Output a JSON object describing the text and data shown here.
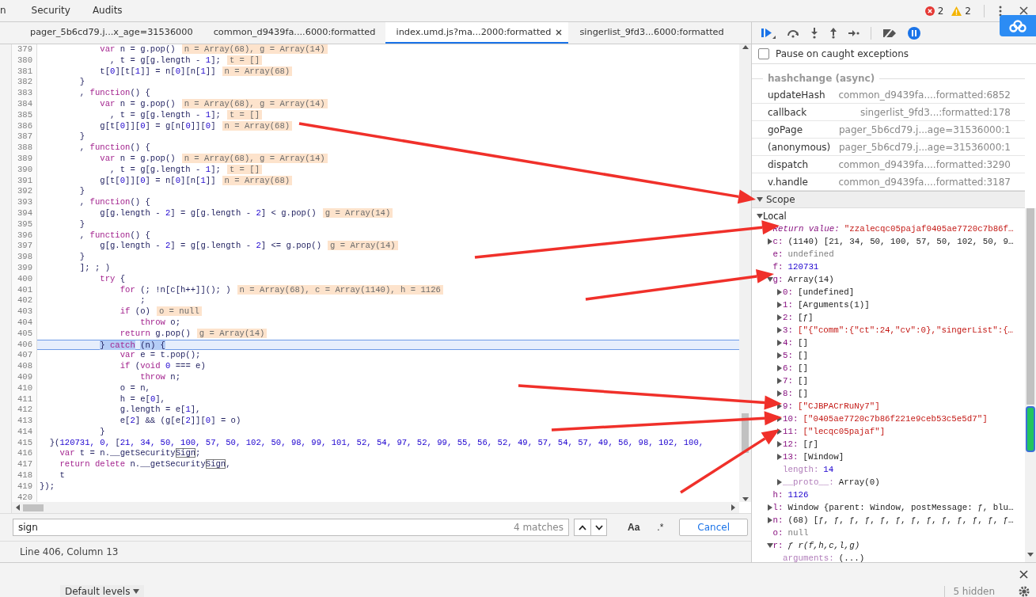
{
  "top_tabs": [
    {
      "label": "n",
      "selected": false
    },
    {
      "label": "Security",
      "selected": false
    },
    {
      "label": "Audits",
      "selected": false
    }
  ],
  "errors": "2",
  "warnings": "2",
  "file_tabs": [
    {
      "label": "pager_5b6cd79.j...x_age=31536000",
      "selected": false
    },
    {
      "label": "common_d9439fa....6000:formatted",
      "selected": false
    },
    {
      "label": "index.umd.js?ma...2000:formatted",
      "selected": true
    },
    {
      "label": "singerlist_9fd3...6000:formatted",
      "selected": false
    }
  ],
  "code_lines": [
    {
      "num": "379",
      "current": false,
      "tokens": [
        {
          "kind": "keyword",
          "text": "            var"
        },
        {
          "kind": "plain",
          "text": " n = g.pop()"
        }
      ],
      "inline": "n = Array(68), g = Array(14)"
    },
    {
      "num": "380",
      "current": false,
      "tokens": [
        {
          "kind": "plain",
          "text": "              , t = g[g.length - "
        },
        {
          "kind": "number",
          "text": "1"
        },
        {
          "kind": "plain",
          "text": "];"
        }
      ],
      "inline": "t = []"
    },
    {
      "num": "381",
      "current": false,
      "tokens": [
        {
          "kind": "plain",
          "text": "            t["
        },
        {
          "kind": "number",
          "text": "0"
        },
        {
          "kind": "plain",
          "text": "][t["
        },
        {
          "kind": "number",
          "text": "1"
        },
        {
          "kind": "plain",
          "text": "]] = n["
        },
        {
          "kind": "number",
          "text": "0"
        },
        {
          "kind": "plain",
          "text": "][n["
        },
        {
          "kind": "number",
          "text": "1"
        },
        {
          "kind": "plain",
          "text": "]]"
        }
      ],
      "inline": "n = Array(68)"
    },
    {
      "num": "382",
      "current": false,
      "tokens": [
        {
          "kind": "plain",
          "text": "        }"
        }
      ]
    },
    {
      "num": "383",
      "current": false,
      "tokens": [
        {
          "kind": "plain",
          "text": "        , "
        },
        {
          "kind": "keyword",
          "text": "function"
        },
        {
          "kind": "plain",
          "text": "() {"
        }
      ]
    },
    {
      "num": "384",
      "current": false,
      "tokens": [
        {
          "kind": "keyword",
          "text": "            var"
        },
        {
          "kind": "plain",
          "text": " n = g.pop()"
        }
      ],
      "inline": "n = Array(68), g = Array(14)"
    },
    {
      "num": "385",
      "current": false,
      "tokens": [
        {
          "kind": "plain",
          "text": "              , t = g[g.length - "
        },
        {
          "kind": "number",
          "text": "1"
        },
        {
          "kind": "plain",
          "text": "];"
        }
      ],
      "inline": "t = []"
    },
    {
      "num": "386",
      "current": false,
      "tokens": [
        {
          "kind": "plain",
          "text": "            g[t["
        },
        {
          "kind": "number",
          "text": "0"
        },
        {
          "kind": "plain",
          "text": "]]["
        },
        {
          "kind": "number",
          "text": "0"
        },
        {
          "kind": "plain",
          "text": "] = g[n["
        },
        {
          "kind": "number",
          "text": "0"
        },
        {
          "kind": "plain",
          "text": "]]["
        },
        {
          "kind": "number",
          "text": "0"
        },
        {
          "kind": "plain",
          "text": "]"
        }
      ],
      "inline": "n = Array(68)"
    },
    {
      "num": "387",
      "current": false,
      "tokens": [
        {
          "kind": "plain",
          "text": "        }"
        }
      ]
    },
    {
      "num": "388",
      "current": false,
      "tokens": [
        {
          "kind": "plain",
          "text": "        , "
        },
        {
          "kind": "keyword",
          "text": "function"
        },
        {
          "kind": "plain",
          "text": "() {"
        }
      ]
    },
    {
      "num": "389",
      "current": false,
      "tokens": [
        {
          "kind": "keyword",
          "text": "            var"
        },
        {
          "kind": "plain",
          "text": " n = g.pop()"
        }
      ],
      "inline": "n = Array(68), g = Array(14)"
    },
    {
      "num": "390",
      "current": false,
      "tokens": [
        {
          "kind": "plain",
          "text": "              , t = g[g.length - "
        },
        {
          "kind": "number",
          "text": "1"
        },
        {
          "kind": "plain",
          "text": "];"
        }
      ],
      "inline": "t = []"
    },
    {
      "num": "391",
      "current": false,
      "tokens": [
        {
          "kind": "plain",
          "text": "            g[t["
        },
        {
          "kind": "number",
          "text": "0"
        },
        {
          "kind": "plain",
          "text": "]]["
        },
        {
          "kind": "number",
          "text": "0"
        },
        {
          "kind": "plain",
          "text": "] = n["
        },
        {
          "kind": "number",
          "text": "0"
        },
        {
          "kind": "plain",
          "text": "][n["
        },
        {
          "kind": "number",
          "text": "1"
        },
        {
          "kind": "plain",
          "text": "]]"
        }
      ],
      "inline": "n = Array(68)"
    },
    {
      "num": "392",
      "current": false,
      "tokens": [
        {
          "kind": "plain",
          "text": "        }"
        }
      ]
    },
    {
      "num": "393",
      "current": false,
      "tokens": [
        {
          "kind": "plain",
          "text": "        , "
        },
        {
          "kind": "keyword",
          "text": "function"
        },
        {
          "kind": "plain",
          "text": "() {"
        }
      ]
    },
    {
      "num": "394",
      "current": false,
      "tokens": [
        {
          "kind": "plain",
          "text": "            g[g.length - "
        },
        {
          "kind": "number",
          "text": "2"
        },
        {
          "kind": "plain",
          "text": "] = g[g.length - "
        },
        {
          "kind": "number",
          "text": "2"
        },
        {
          "kind": "plain",
          "text": "] < g.pop()"
        }
      ],
      "inline": "g = Array(14)"
    },
    {
      "num": "395",
      "current": false,
      "tokens": [
        {
          "kind": "plain",
          "text": "        }"
        }
      ]
    },
    {
      "num": "396",
      "current": false,
      "tokens": [
        {
          "kind": "plain",
          "text": "        , "
        },
        {
          "kind": "keyword",
          "text": "function"
        },
        {
          "kind": "plain",
          "text": "() {"
        }
      ]
    },
    {
      "num": "397",
      "current": false,
      "tokens": [
        {
          "kind": "plain",
          "text": "            g[g.length - "
        },
        {
          "kind": "number",
          "text": "2"
        },
        {
          "kind": "plain",
          "text": "] = g[g.length - "
        },
        {
          "kind": "number",
          "text": "2"
        },
        {
          "kind": "plain",
          "text": "] <= g.pop()"
        }
      ],
      "inline": "g = Array(14)"
    },
    {
      "num": "398",
      "current": false,
      "tokens": [
        {
          "kind": "plain",
          "text": "        }"
        }
      ]
    },
    {
      "num": "399",
      "current": false,
      "tokens": [
        {
          "kind": "plain",
          "text": "        ]; ; )"
        }
      ]
    },
    {
      "num": "400",
      "current": false,
      "tokens": [
        {
          "kind": "keyword",
          "text": "            try"
        },
        {
          "kind": "plain",
          "text": " {"
        }
      ]
    },
    {
      "num": "401",
      "current": false,
      "tokens": [
        {
          "kind": "keyword",
          "text": "                for"
        },
        {
          "kind": "plain",
          "text": " (; !n[c[h++]](); )"
        }
      ],
      "inline": "n = Array(68), c = Array(1140), h = 1126"
    },
    {
      "num": "402",
      "current": false,
      "tokens": [
        {
          "kind": "plain",
          "text": "                    ;"
        }
      ]
    },
    {
      "num": "403",
      "current": false,
      "tokens": [
        {
          "kind": "keyword",
          "text": "                if"
        },
        {
          "kind": "plain",
          "text": " (o)"
        }
      ],
      "inline": "o = null"
    },
    {
      "num": "404",
      "current": false,
      "tokens": [
        {
          "kind": "keyword",
          "text": "                    throw"
        },
        {
          "kind": "plain",
          "text": " o;"
        }
      ]
    },
    {
      "num": "405",
      "current": false,
      "tokens": [
        {
          "kind": "keyword",
          "text": "                return"
        },
        {
          "kind": "plain",
          "text": " g.pop()"
        }
      ],
      "inline": "g = Array(14)"
    },
    {
      "num": "406",
      "current": true,
      "tokens": [
        {
          "kind": "selected_plain",
          "text": "            } "
        },
        {
          "kind": "selected_keyword",
          "text": "catch"
        },
        {
          "kind": "selected_plain",
          "text": " (n) {"
        }
      ]
    },
    {
      "num": "407",
      "current": false,
      "tokens": [
        {
          "kind": "keyword",
          "text": "                var"
        },
        {
          "kind": "plain",
          "text": " e = t.pop();"
        }
      ]
    },
    {
      "num": "408",
      "current": false,
      "tokens": [
        {
          "kind": "keyword",
          "text": "                if"
        },
        {
          "kind": "plain",
          "text": " ("
        },
        {
          "kind": "keyword",
          "text": "void"
        },
        {
          "kind": "number",
          "text": " 0"
        },
        {
          "kind": "plain",
          "text": " === e)"
        }
      ]
    },
    {
      "num": "409",
      "current": false,
      "tokens": [
        {
          "kind": "keyword",
          "text": "                    throw"
        },
        {
          "kind": "plain",
          "text": " n;"
        }
      ]
    },
    {
      "num": "410",
      "current": false,
      "tokens": [
        {
          "kind": "plain",
          "text": "                o = n,"
        }
      ]
    },
    {
      "num": "411",
      "current": false,
      "tokens": [
        {
          "kind": "plain",
          "text": "                h = e["
        },
        {
          "kind": "number",
          "text": "0"
        },
        {
          "kind": "plain",
          "text": "],"
        }
      ]
    },
    {
      "num": "412",
      "current": false,
      "tokens": [
        {
          "kind": "plain",
          "text": "                g.length = e["
        },
        {
          "kind": "number",
          "text": "1"
        },
        {
          "kind": "plain",
          "text": "],"
        }
      ]
    },
    {
      "num": "413",
      "current": false,
      "tokens": [
        {
          "kind": "plain",
          "text": "                e["
        },
        {
          "kind": "number",
          "text": "2"
        },
        {
          "kind": "plain",
          "text": "] && (g[e["
        },
        {
          "kind": "number",
          "text": "2"
        },
        {
          "kind": "plain",
          "text": "]]["
        },
        {
          "kind": "number",
          "text": "0"
        },
        {
          "kind": "plain",
          "text": "] = o)"
        }
      ]
    },
    {
      "num": "414",
      "current": false,
      "tokens": [
        {
          "kind": "plain",
          "text": "            }"
        }
      ]
    },
    {
      "num": "415",
      "current": false,
      "tokens": [
        {
          "kind": "plain",
          "text": "  }("
        },
        {
          "kind": "number",
          "text": "120731, 0, "
        },
        {
          "kind": "plain",
          "text": "["
        },
        {
          "kind": "number",
          "text": "21, 34, 50, 100, 57, 50, 102, 50, 98, 99, 101, 52, 54, 97, 52, 99, 55, 56, 52, 49, 57, 54, 57, 49, 56, 98, 102, 100,"
        }
      ]
    },
    {
      "num": "416",
      "current": false,
      "tokens": [
        {
          "kind": "keyword",
          "text": "    var"
        },
        {
          "kind": "plain",
          "text": " t = n.__getSecurity"
        },
        {
          "kind": "match",
          "text": "Sign"
        },
        {
          "kind": "plain",
          "text": ";"
        }
      ]
    },
    {
      "num": "417",
      "current": false,
      "tokens": [
        {
          "kind": "keyword",
          "text": "    return delete"
        },
        {
          "kind": "plain",
          "text": " n.__getSecurity"
        },
        {
          "kind": "match",
          "text": "Sign"
        },
        {
          "kind": "plain",
          "text": ","
        }
      ]
    },
    {
      "num": "418",
      "current": false,
      "tokens": [
        {
          "kind": "plain",
          "text": "    t"
        }
      ]
    },
    {
      "num": "419",
      "current": false,
      "tokens": [
        {
          "kind": "plain",
          "text": "});"
        }
      ]
    },
    {
      "num": "420",
      "current": false
    }
  ],
  "search": {
    "value": "sign",
    "matches": "4 matches",
    "case_label": "Aa",
    "regex_label": ".*",
    "cancel": "Cancel"
  },
  "status": "Line 406, Column 13",
  "pause_on_caught": {
    "label": "Pause on caught exceptions",
    "checked": false
  },
  "call_stack": {
    "async_label": "hashchange (async)",
    "frames": [
      {
        "name": "updateHash",
        "location": "common_d9439fa....formatted:6852"
      },
      {
        "name": "callback",
        "location": "singerlist_9fd3...:formatted:178"
      },
      {
        "name": "goPage",
        "location": "pager_5b6cd79.j...age=31536000:1"
      },
      {
        "name": "(anonymous)",
        "location": "pager_5b6cd79.j...age=31536000:1"
      },
      {
        "name": "dispatch",
        "location": "common_d9439fa....formatted:3290"
      },
      {
        "name": "v.handle",
        "location": "common_d9439fa....formatted:3187"
      }
    ]
  },
  "scope": {
    "title": "Scope",
    "expanded": true,
    "tree": [
      {
        "name": "Local",
        "kind": "scope",
        "expanded": true,
        "children": [
          {
            "name": "Return value:",
            "kind": "return",
            "value": {
              "kind": "string",
              "text": "\"zzalecqc05pajaf0405ae7720c7b86f…"
            }
          },
          {
            "name": "c:",
            "kind": "prop",
            "value": {
              "kind": "object",
              "text": "(1140) [21, 34, 50, 100, 57, 50, 102, 50, 9…"
            },
            "expanded": false
          },
          {
            "name": "e:",
            "kind": "prop",
            "value": {
              "kind": "empty",
              "text": "undefined"
            }
          },
          {
            "name": "f:",
            "kind": "prop",
            "value": {
              "kind": "number",
              "text": "120731"
            }
          },
          {
            "name": "g:",
            "kind": "prop",
            "value": {
              "kind": "object",
              "text": "Array(14)"
            },
            "expanded": true,
            "children": [
              {
                "name": "0:",
                "kind": "prop",
                "value": {
                  "kind": "object",
                  "text": "[undefined]"
                },
                "expanded": false
              },
              {
                "name": "1:",
                "kind": "prop",
                "value": {
                  "kind": "object",
                  "text": "[Arguments(1)]"
                },
                "expanded": false
              },
              {
                "name": "2:",
                "kind": "prop",
                "value": {
                  "kind": "object",
                  "text": "[ƒ]"
                },
                "expanded": false
              },
              {
                "name": "3:",
                "kind": "prop",
                "value": {
                  "kind": "string",
                  "text": "[\"{\"comm\":{\"ct\":24,\"cv\":0},\"singerList\":{…"
                },
                "expanded": false
              },
              {
                "name": "4:",
                "kind": "prop",
                "value": {
                  "kind": "object",
                  "text": "[]"
                },
                "expanded": false
              },
              {
                "name": "5:",
                "kind": "prop",
                "value": {
                  "kind": "object",
                  "text": "[]"
                },
                "expanded": false
              },
              {
                "name": "6:",
                "kind": "prop",
                "value": {
                  "kind": "object",
                  "text": "[]"
                },
                "expanded": false
              },
              {
                "name": "7:",
                "kind": "prop",
                "value": {
                  "kind": "object",
                  "text": "[]"
                },
                "expanded": false
              },
              {
                "name": "8:",
                "kind": "prop",
                "value": {
                  "kind": "object",
                  "text": "[]"
                },
                "expanded": false
              },
              {
                "name": "9:",
                "kind": "prop",
                "value": {
                  "kind": "string",
                  "text": "[\"CJBPACrRuNy7\"]"
                },
                "expanded": false
              },
              {
                "name": "10:",
                "kind": "prop",
                "value": {
                  "kind": "string",
                  "text": "[\"0405ae7720c7b86f221e9ceb53c5e5d7\"]"
                },
                "expanded": false
              },
              {
                "name": "11:",
                "kind": "prop",
                "value": {
                  "kind": "string",
                  "text": "[\"lecqc05pajaf\"]"
                },
                "expanded": false
              },
              {
                "name": "12:",
                "kind": "prop",
                "value": {
                  "kind": "object",
                  "text": "[ƒ]"
                },
                "expanded": false
              },
              {
                "name": "13:",
                "kind": "prop",
                "value": {
                  "kind": "object",
                  "text": "[Window]"
                },
                "expanded": false
              },
              {
                "name": "length:",
                "kind": "meta",
                "value": {
                  "kind": "number",
                  "text": "14"
                }
              },
              {
                "name": "__proto__:",
                "kind": "meta",
                "value": {
                  "kind": "object",
                  "text": "Array(0)"
                },
                "expanded": false
              }
            ]
          },
          {
            "name": "h:",
            "kind": "prop",
            "value": {
              "kind": "number",
              "text": "1126"
            }
          },
          {
            "name": "l:",
            "kind": "prop",
            "value": {
              "kind": "object",
              "text": "Window {parent: Window, postMessage: ƒ, blu…"
            },
            "expanded": false
          },
          {
            "name": "n:",
            "kind": "prop",
            "value": {
              "kind": "object",
              "text": "(68) [ƒ, ƒ, ƒ, ƒ, ƒ, ƒ, ƒ, ƒ, ƒ, ƒ, ƒ, ƒ, ƒ…"
            },
            "expanded": false
          },
          {
            "name": "o:",
            "kind": "prop",
            "value": {
              "kind": "empty",
              "text": "null"
            }
          },
          {
            "name": "r:",
            "kind": "prop",
            "value": {
              "kind": "function",
              "text": "ƒ r(f,h,c,l,g)"
            },
            "expanded": true,
            "children": [
              {
                "name": "arguments:",
                "kind": "meta",
                "value": {
                  "kind": "object",
                  "text": "(...)"
                }
              }
            ]
          }
        ]
      }
    ]
  },
  "console": {
    "levels": "Default levels",
    "hidden": "5 hidden"
  }
}
